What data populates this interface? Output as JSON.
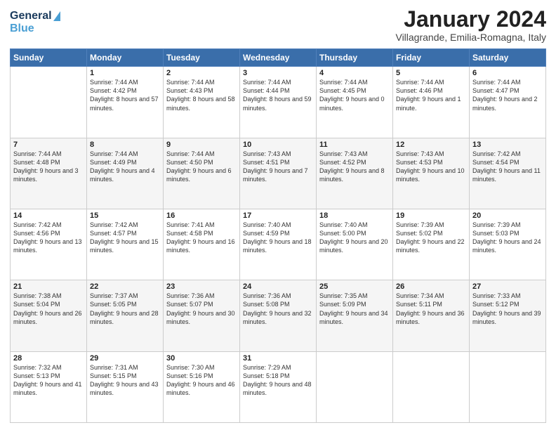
{
  "header": {
    "logo_general": "General",
    "logo_blue": "Blue",
    "main_title": "January 2024",
    "subtitle": "Villagrande, Emilia-Romagna, Italy"
  },
  "days_of_week": [
    "Sunday",
    "Monday",
    "Tuesday",
    "Wednesday",
    "Thursday",
    "Friday",
    "Saturday"
  ],
  "weeks": [
    [
      {
        "day": "",
        "sunrise": "",
        "sunset": "",
        "daylight": ""
      },
      {
        "day": "1",
        "sunrise": "Sunrise: 7:44 AM",
        "sunset": "Sunset: 4:42 PM",
        "daylight": "Daylight: 8 hours and 57 minutes."
      },
      {
        "day": "2",
        "sunrise": "Sunrise: 7:44 AM",
        "sunset": "Sunset: 4:43 PM",
        "daylight": "Daylight: 8 hours and 58 minutes."
      },
      {
        "day": "3",
        "sunrise": "Sunrise: 7:44 AM",
        "sunset": "Sunset: 4:44 PM",
        "daylight": "Daylight: 8 hours and 59 minutes."
      },
      {
        "day": "4",
        "sunrise": "Sunrise: 7:44 AM",
        "sunset": "Sunset: 4:45 PM",
        "daylight": "Daylight: 9 hours and 0 minutes."
      },
      {
        "day": "5",
        "sunrise": "Sunrise: 7:44 AM",
        "sunset": "Sunset: 4:46 PM",
        "daylight": "Daylight: 9 hours and 1 minute."
      },
      {
        "day": "6",
        "sunrise": "Sunrise: 7:44 AM",
        "sunset": "Sunset: 4:47 PM",
        "daylight": "Daylight: 9 hours and 2 minutes."
      }
    ],
    [
      {
        "day": "7",
        "sunrise": "Sunrise: 7:44 AM",
        "sunset": "Sunset: 4:48 PM",
        "daylight": "Daylight: 9 hours and 3 minutes."
      },
      {
        "day": "8",
        "sunrise": "Sunrise: 7:44 AM",
        "sunset": "Sunset: 4:49 PM",
        "daylight": "Daylight: 9 hours and 4 minutes."
      },
      {
        "day": "9",
        "sunrise": "Sunrise: 7:44 AM",
        "sunset": "Sunset: 4:50 PM",
        "daylight": "Daylight: 9 hours and 6 minutes."
      },
      {
        "day": "10",
        "sunrise": "Sunrise: 7:43 AM",
        "sunset": "Sunset: 4:51 PM",
        "daylight": "Daylight: 9 hours and 7 minutes."
      },
      {
        "day": "11",
        "sunrise": "Sunrise: 7:43 AM",
        "sunset": "Sunset: 4:52 PM",
        "daylight": "Daylight: 9 hours and 8 minutes."
      },
      {
        "day": "12",
        "sunrise": "Sunrise: 7:43 AM",
        "sunset": "Sunset: 4:53 PM",
        "daylight": "Daylight: 9 hours and 10 minutes."
      },
      {
        "day": "13",
        "sunrise": "Sunrise: 7:42 AM",
        "sunset": "Sunset: 4:54 PM",
        "daylight": "Daylight: 9 hours and 11 minutes."
      }
    ],
    [
      {
        "day": "14",
        "sunrise": "Sunrise: 7:42 AM",
        "sunset": "Sunset: 4:56 PM",
        "daylight": "Daylight: 9 hours and 13 minutes."
      },
      {
        "day": "15",
        "sunrise": "Sunrise: 7:42 AM",
        "sunset": "Sunset: 4:57 PM",
        "daylight": "Daylight: 9 hours and 15 minutes."
      },
      {
        "day": "16",
        "sunrise": "Sunrise: 7:41 AM",
        "sunset": "Sunset: 4:58 PM",
        "daylight": "Daylight: 9 hours and 16 minutes."
      },
      {
        "day": "17",
        "sunrise": "Sunrise: 7:40 AM",
        "sunset": "Sunset: 4:59 PM",
        "daylight": "Daylight: 9 hours and 18 minutes."
      },
      {
        "day": "18",
        "sunrise": "Sunrise: 7:40 AM",
        "sunset": "Sunset: 5:00 PM",
        "daylight": "Daylight: 9 hours and 20 minutes."
      },
      {
        "day": "19",
        "sunrise": "Sunrise: 7:39 AM",
        "sunset": "Sunset: 5:02 PM",
        "daylight": "Daylight: 9 hours and 22 minutes."
      },
      {
        "day": "20",
        "sunrise": "Sunrise: 7:39 AM",
        "sunset": "Sunset: 5:03 PM",
        "daylight": "Daylight: 9 hours and 24 minutes."
      }
    ],
    [
      {
        "day": "21",
        "sunrise": "Sunrise: 7:38 AM",
        "sunset": "Sunset: 5:04 PM",
        "daylight": "Daylight: 9 hours and 26 minutes."
      },
      {
        "day": "22",
        "sunrise": "Sunrise: 7:37 AM",
        "sunset": "Sunset: 5:05 PM",
        "daylight": "Daylight: 9 hours and 28 minutes."
      },
      {
        "day": "23",
        "sunrise": "Sunrise: 7:36 AM",
        "sunset": "Sunset: 5:07 PM",
        "daylight": "Daylight: 9 hours and 30 minutes."
      },
      {
        "day": "24",
        "sunrise": "Sunrise: 7:36 AM",
        "sunset": "Sunset: 5:08 PM",
        "daylight": "Daylight: 9 hours and 32 minutes."
      },
      {
        "day": "25",
        "sunrise": "Sunrise: 7:35 AM",
        "sunset": "Sunset: 5:09 PM",
        "daylight": "Daylight: 9 hours and 34 minutes."
      },
      {
        "day": "26",
        "sunrise": "Sunrise: 7:34 AM",
        "sunset": "Sunset: 5:11 PM",
        "daylight": "Daylight: 9 hours and 36 minutes."
      },
      {
        "day": "27",
        "sunrise": "Sunrise: 7:33 AM",
        "sunset": "Sunset: 5:12 PM",
        "daylight": "Daylight: 9 hours and 39 minutes."
      }
    ],
    [
      {
        "day": "28",
        "sunrise": "Sunrise: 7:32 AM",
        "sunset": "Sunset: 5:13 PM",
        "daylight": "Daylight: 9 hours and 41 minutes."
      },
      {
        "day": "29",
        "sunrise": "Sunrise: 7:31 AM",
        "sunset": "Sunset: 5:15 PM",
        "daylight": "Daylight: 9 hours and 43 minutes."
      },
      {
        "day": "30",
        "sunrise": "Sunrise: 7:30 AM",
        "sunset": "Sunset: 5:16 PM",
        "daylight": "Daylight: 9 hours and 46 minutes."
      },
      {
        "day": "31",
        "sunrise": "Sunrise: 7:29 AM",
        "sunset": "Sunset: 5:18 PM",
        "daylight": "Daylight: 9 hours and 48 minutes."
      },
      {
        "day": "",
        "sunrise": "",
        "sunset": "",
        "daylight": ""
      },
      {
        "day": "",
        "sunrise": "",
        "sunset": "",
        "daylight": ""
      },
      {
        "day": "",
        "sunrise": "",
        "sunset": "",
        "daylight": ""
      }
    ]
  ]
}
